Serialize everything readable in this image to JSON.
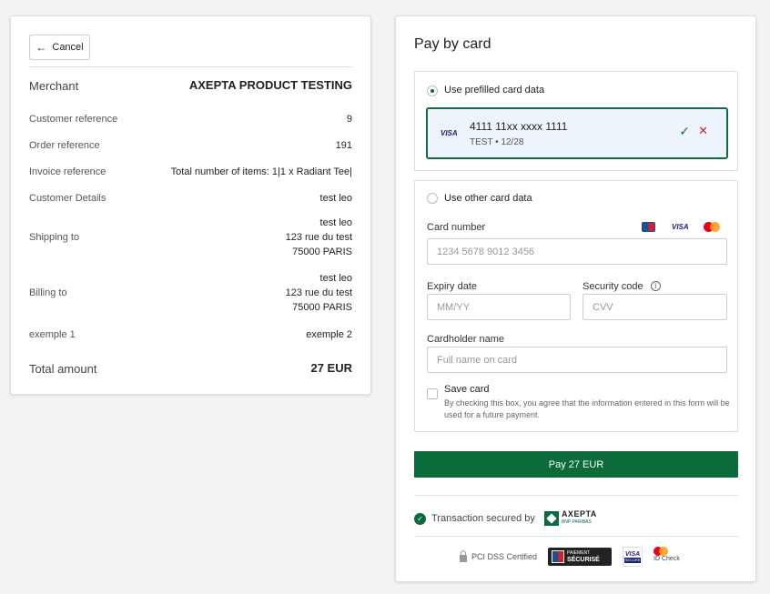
{
  "summary": {
    "cancel_label": "Cancel",
    "merchant_label": "Merchant",
    "merchant_value": "AXEPTA PRODUCT TESTING",
    "customer_ref_label": "Customer reference",
    "customer_ref_value": "9",
    "order_ref_label": "Order reference",
    "order_ref_value": "191",
    "invoice_ref_label": "Invoice reference",
    "invoice_ref_value": "Total number of items: 1|1 x Radiant Tee|",
    "customer_details_label": "Customer Details",
    "customer_details_value": "test leo",
    "shipping_label": "Shipping to",
    "shipping_lines": [
      "test leo",
      "123 rue du test",
      "75000 PARIS"
    ],
    "billing_label": "Billing to",
    "billing_lines": [
      "test leo",
      "123 rue du test",
      "75000 PARIS"
    ],
    "extra_label": "exemple 1",
    "extra_value": "exemple 2",
    "total_label": "Total amount",
    "total_value": "27 EUR"
  },
  "payment": {
    "title": "Pay by card",
    "prefilled_label": "Use prefilled card data",
    "saved_card_brand": "VISA",
    "saved_card_number": "4111 11xx xxxx 1111",
    "saved_card_sub": "TEST • 12/28",
    "other_label": "Use other card data",
    "card_number_label": "Card number",
    "card_number_placeholder": "1234 5678 9012 3456",
    "brand_visa": "VISA",
    "expiry_label": "Expiry date",
    "expiry_placeholder": "MM/YY",
    "security_label": "Security code",
    "security_placeholder": "CVV",
    "cardholder_label": "Cardholder name",
    "cardholder_placeholder": "Full name on card",
    "save_card_label": "Save card",
    "save_card_desc": "By checking this box, you agree that the information entered in this form will be used for a future payment.",
    "pay_button": "Pay 27 EUR",
    "secured_text": "Transaction secured by",
    "axepta_name": "AXEPTA",
    "axepta_sub": "BNP PARIBAS",
    "pci_label": "PCI DSS Certified",
    "paiement_line1": "PAIEMENT",
    "paiement_line2": "SÉCURISÉ",
    "visa_secure_v": "VISA",
    "visa_secure_s": "SECURE",
    "id_check": "ID Check"
  },
  "colors": {
    "accent_green": "#0b6b3a",
    "error_red": "#d4202a",
    "visa_blue": "#1a1f71"
  }
}
